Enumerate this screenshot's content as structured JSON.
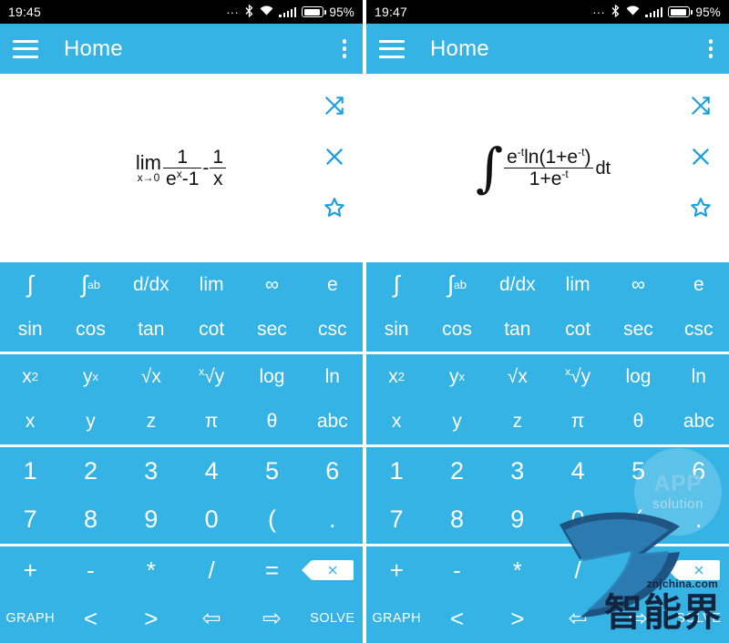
{
  "colors": {
    "accent": "#35b3e5",
    "statusbar_bg": "#010101",
    "key_text": "#ffffff",
    "icon_blue": "#1e9fe0",
    "expr_text": "#111111",
    "page_bg": "#ffffff"
  },
  "panels": [
    {
      "status": {
        "time": "19:45",
        "dots": "...",
        "bluetooth_icon": "bluetooth-icon",
        "wifi_icon": "wifi-icon",
        "signal_icon": "signal-icon",
        "battery_icon": "battery-icon",
        "battery_percent": "95%"
      },
      "appbar": {
        "menu_icon": "hamburger-menu-icon",
        "title": "Home",
        "overflow_icon": "overflow-menu-icon"
      },
      "expression": {
        "kind": "limit",
        "latex": "lim_{x->0} ( 1/(e^x - 1) - 1/x )",
        "lim_label": "lim",
        "lim_sub": "x→0",
        "frac1_num": "1",
        "frac1_den_base": "e",
        "frac1_den_exp": "x",
        "frac1_den_tail": "-1",
        "minus": "-",
        "frac2_num": "1",
        "frac2_den": "x"
      },
      "actions": [
        {
          "name": "shuffle-icon",
          "label": "shuffle"
        },
        {
          "name": "close-icon",
          "label": "clear"
        },
        {
          "name": "star-icon",
          "label": "favorite"
        }
      ]
    },
    {
      "status": {
        "time": "19:47",
        "dots": "...",
        "bluetooth_icon": "bluetooth-icon",
        "wifi_icon": "wifi-icon",
        "signal_icon": "signal-icon",
        "battery_icon": "battery-icon",
        "battery_percent": "95%"
      },
      "appbar": {
        "menu_icon": "hamburger-menu-icon",
        "title": "Home",
        "overflow_icon": "overflow-menu-icon"
      },
      "expression": {
        "kind": "integral",
        "latex": "∫ e^{-t} ln(1+e^{-t}) / (1+e^{-t}) dt",
        "integral_symbol": "∫",
        "num_base": "e",
        "num_exp": "-t",
        "num_fn": "ln(1+e",
        "num_fn_exp": "-t",
        "num_fn_close": ")",
        "den_base": "1+e",
        "den_exp": "-t",
        "differential": "dt"
      },
      "actions": [
        {
          "name": "shuffle-icon",
          "label": "shuffle"
        },
        {
          "name": "close-icon",
          "label": "clear"
        },
        {
          "name": "star-icon",
          "label": "favorite"
        }
      ]
    }
  ],
  "keypad": {
    "blocks": [
      {
        "name": "functions-block",
        "rows": [
          {
            "name": "calculus-row",
            "keys": [
              {
                "label": "∫",
                "name": "key-integral",
                "style": "op"
              },
              {
                "label": "∫",
                "sub": "a",
                "sup": "b",
                "name": "key-definite-integral",
                "style": "op"
              },
              {
                "label": "d/dx",
                "name": "key-derivative",
                "style": ""
              },
              {
                "label": "lim",
                "name": "key-limit",
                "style": ""
              },
              {
                "label": "∞",
                "name": "key-infinity",
                "style": ""
              },
              {
                "label": "e",
                "name": "key-e",
                "style": ""
              }
            ]
          },
          {
            "name": "trig-row",
            "keys": [
              {
                "label": "sin",
                "name": "key-sin",
                "style": ""
              },
              {
                "label": "cos",
                "name": "key-cos",
                "style": ""
              },
              {
                "label": "tan",
                "name": "key-tan",
                "style": ""
              },
              {
                "label": "cot",
                "name": "key-cot",
                "style": ""
              },
              {
                "label": "sec",
                "name": "key-sec",
                "style": ""
              },
              {
                "label": "csc",
                "name": "key-csc",
                "style": ""
              }
            ]
          }
        ]
      },
      {
        "name": "algebra-block",
        "rows": [
          {
            "name": "power-row",
            "keys": [
              {
                "label": "x",
                "sup": "2",
                "name": "key-x-squared",
                "style": ""
              },
              {
                "label": "y",
                "sup": "x",
                "name": "key-y-to-x",
                "style": ""
              },
              {
                "label": "√x",
                "name": "key-sqrt-x",
                "style": ""
              },
              {
                "label": "√y",
                "pre": "x",
                "name": "key-nth-root",
                "style": ""
              },
              {
                "label": "log",
                "name": "key-log",
                "style": ""
              },
              {
                "label": "ln",
                "name": "key-ln",
                "style": ""
              }
            ]
          },
          {
            "name": "variables-row",
            "keys": [
              {
                "label": "x",
                "name": "key-x",
                "style": ""
              },
              {
                "label": "y",
                "name": "key-y",
                "style": ""
              },
              {
                "label": "z",
                "name": "key-z",
                "style": ""
              },
              {
                "label": "π",
                "name": "key-pi",
                "style": ""
              },
              {
                "label": "θ",
                "name": "key-theta",
                "style": ""
              },
              {
                "label": "abc",
                "name": "key-abc",
                "style": ""
              }
            ]
          }
        ]
      },
      {
        "name": "numeric-block",
        "rows": [
          {
            "name": "digits-row-1",
            "keys": [
              {
                "label": "1",
                "name": "key-1",
                "style": "big"
              },
              {
                "label": "2",
                "name": "key-2",
                "style": "big"
              },
              {
                "label": "3",
                "name": "key-3",
                "style": "big"
              },
              {
                "label": "4",
                "name": "key-4",
                "style": "big"
              },
              {
                "label": "5",
                "name": "key-5",
                "style": "big"
              },
              {
                "label": "6",
                "name": "key-6",
                "style": "big"
              }
            ]
          },
          {
            "name": "digits-row-2",
            "keys": [
              {
                "label": "7",
                "name": "key-7",
                "style": "big"
              },
              {
                "label": "8",
                "name": "key-8",
                "style": "big"
              },
              {
                "label": "9",
                "name": "key-9",
                "style": "big"
              },
              {
                "label": "0",
                "name": "key-0",
                "style": "big"
              },
              {
                "label": "(",
                "name": "key-open-paren",
                "style": "big"
              },
              {
                "label": ".",
                "name": "key-decimal-point",
                "style": "big"
              }
            ]
          }
        ]
      },
      {
        "name": "operators-block",
        "rows": [
          {
            "name": "operators-row",
            "keys": [
              {
                "label": "+",
                "name": "key-plus",
                "style": "op"
              },
              {
                "label": "-",
                "name": "key-minus",
                "style": "op"
              },
              {
                "label": "*",
                "name": "key-multiply",
                "style": "op"
              },
              {
                "label": "/",
                "name": "key-divide",
                "style": "op"
              },
              {
                "label": "=",
                "name": "key-equals",
                "style": "op"
              },
              {
                "label": "",
                "name": "key-backspace",
                "style": "backspace",
                "icon": "backspace-icon"
              }
            ]
          },
          {
            "name": "controls-row",
            "keys": [
              {
                "label": "GRAPH",
                "name": "key-graph",
                "style": "small"
              },
              {
                "label": "<",
                "name": "key-less-than",
                "style": "op"
              },
              {
                "label": ">",
                "name": "key-greater-than",
                "style": "op"
              },
              {
                "label": "⇦",
                "name": "key-cursor-left",
                "style": "arrow"
              },
              {
                "label": "⇨",
                "name": "key-cursor-right",
                "style": "arrow"
              },
              {
                "label": "SOLVE",
                "name": "key-solve",
                "style": "small"
              }
            ]
          }
        ]
      }
    ]
  },
  "watermarks": {
    "app_solution_line1": "APP",
    "app_solution_line2": "solution",
    "znjchina_url": "znjchina.com",
    "znjchina_name": "智能界"
  }
}
